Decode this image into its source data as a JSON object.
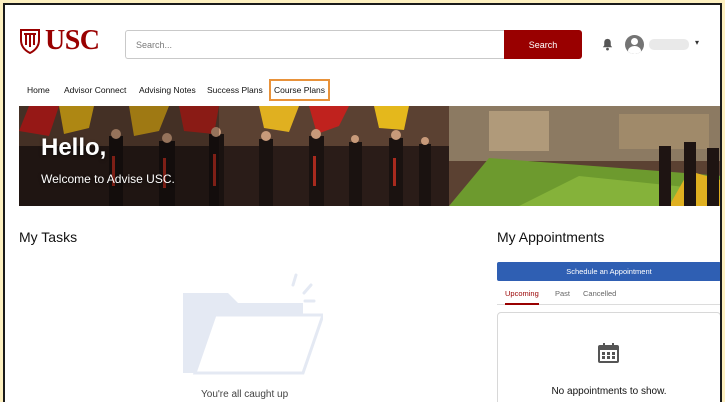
{
  "header": {
    "logo_text": "USC",
    "search_placeholder": "Search...",
    "search_button": "Search"
  },
  "nav": {
    "items": [
      "Home",
      "Advisor Connect",
      "Advising Notes",
      "Success Plans",
      "Course Plans"
    ],
    "active": "Course Plans"
  },
  "hero": {
    "greeting": "Hello,",
    "subtitle": "Welcome to Advise USC."
  },
  "tasks": {
    "title": "My Tasks",
    "empty_message": "You're all caught up"
  },
  "appointments": {
    "title": "My Appointments",
    "schedule_button": "Schedule an Appointment",
    "tabs": [
      "Upcoming",
      "Past",
      "Cancelled"
    ],
    "active_tab": "Upcoming",
    "empty_message": "No appointments to show."
  },
  "colors": {
    "brand": "#990000",
    "accent_blue": "#2f5fb3",
    "active_nav_outline": "#e8923a",
    "frame_background": "#fdf0c0"
  },
  "icons": [
    "usc-seal-icon",
    "bell-icon",
    "user-avatar-icon",
    "chevron-down-icon",
    "folder-icon",
    "calendar-icon"
  ]
}
